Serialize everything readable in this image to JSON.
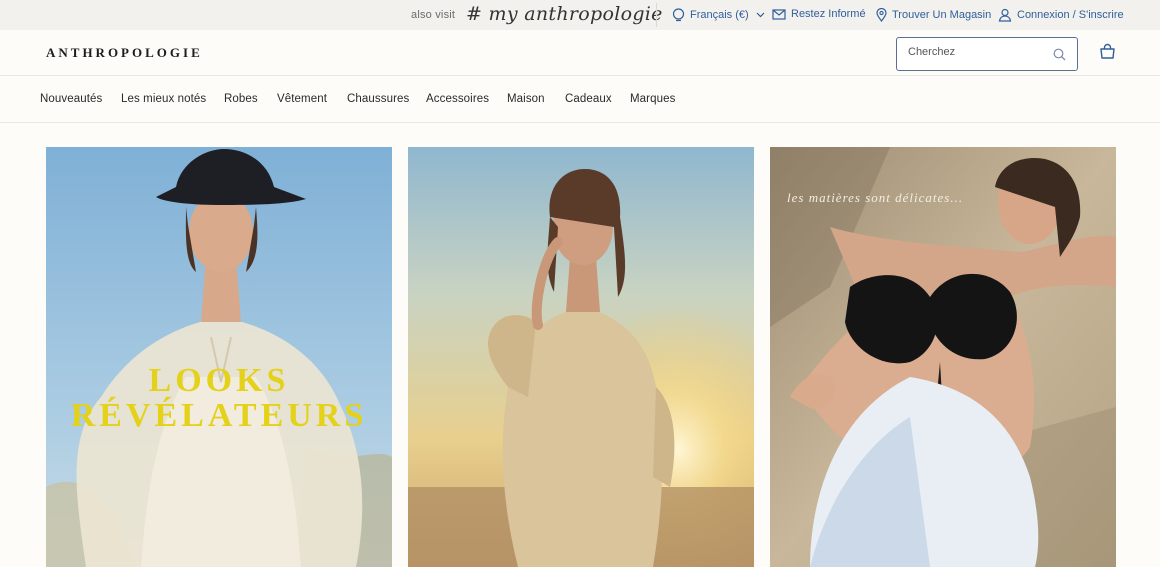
{
  "utility_bar": {
    "also_visit": "also visit",
    "my_anthro": "# my anthropologie",
    "language": "Français (€)",
    "newsletter": "Restez Informé",
    "store_locator": "Trouver Un Magasin",
    "account": "Connexion / S'inscrire",
    "link_color": "#2f5f9c"
  },
  "header": {
    "logo": "ANTHROPOLOGIE",
    "search_placeholder": "Cherchez"
  },
  "nav": {
    "items": [
      {
        "label": "Nouveautés"
      },
      {
        "label": "Les mieux notés"
      },
      {
        "label": "Robes"
      },
      {
        "label": "Vêtement"
      },
      {
        "label": "Chaussures"
      },
      {
        "label": "Accessoires"
      },
      {
        "label": "Maison"
      },
      {
        "label": "Cadeaux"
      },
      {
        "label": "Marques"
      }
    ]
  },
  "tiles": [
    {
      "overlay_line1": "LOOKS",
      "overlay_line2": "RÉVÉLATEURS",
      "overlay_color": "#e3d11a"
    },
    {},
    {
      "caption": "les matières sont délicates..."
    }
  ]
}
